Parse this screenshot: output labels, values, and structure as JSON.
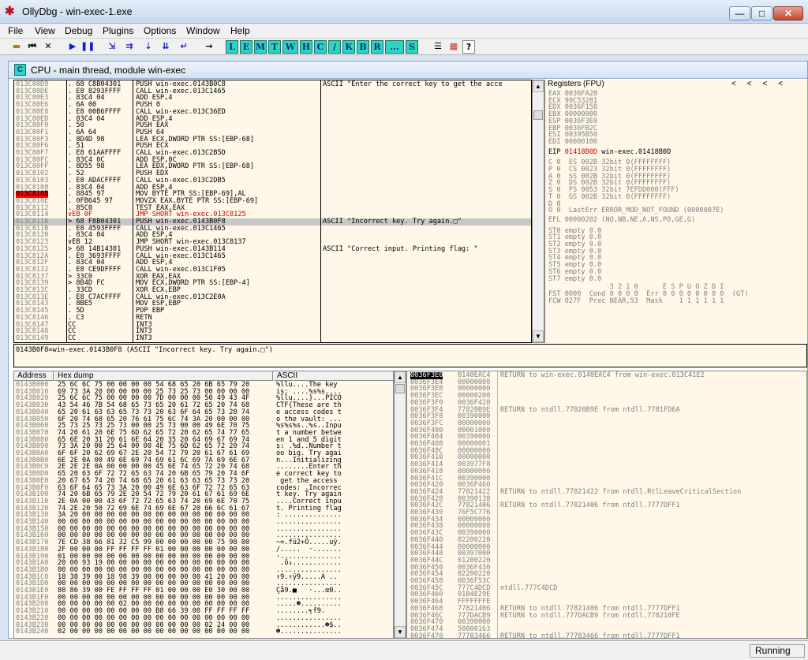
{
  "window": {
    "title": "OllyDbg - win-exec-1.exe",
    "min": "—",
    "max": "□",
    "close": "✕"
  },
  "menu": [
    "File",
    "View",
    "Debug",
    "Plugins",
    "Options",
    "Window",
    "Help"
  ],
  "toolbar": {
    "icons": [
      "open-icon",
      "rewind-icon",
      "close-program-icon",
      "run-icon",
      "pause-icon",
      "step-into-icon",
      "step-over-icon",
      "trace-into-icon",
      "trace-over-icon",
      "execute-till-return-icon",
      "go-to-icon"
    ],
    "letters": [
      "L",
      "E",
      "M",
      "T",
      "W",
      "H",
      "C",
      "/",
      "K",
      "B",
      "R",
      "...",
      "S"
    ],
    "extra_icons": [
      "list-icon",
      "color-grid-icon",
      "help-icon"
    ],
    "help_label": "?"
  },
  "cpu": {
    "icon_label": "C",
    "title": "CPU - main thread, module win-exec"
  },
  "disasm": {
    "rows": [
      [
        "013C80D9",
        ". 68 C8B04301",
        "PUSH win-exec.0143B0C8",
        "ASCII \"Enter the correct key to get the acce"
      ],
      [
        "013C80DE",
        ". E8 8293FFFF",
        "CALL win-exec.013C1465",
        ""
      ],
      [
        "013C80E3",
        ". 83C4 04",
        "ADD ESP,4",
        ""
      ],
      [
        "013C80E6",
        ". 6A 00",
        "PUSH 0",
        ""
      ],
      [
        "013C80E8",
        ". E8 00B6FFFF",
        "CALL win-exec.013C36ED",
        ""
      ],
      [
        "013C80ED",
        ". 83C4 04",
        "ADD ESP,4",
        ""
      ],
      [
        "013C80F0",
        ". 50",
        "PUSH EAX",
        ""
      ],
      [
        "013C80F1",
        ". 6A 64",
        "PUSH 64",
        ""
      ],
      [
        "013C80F3",
        ". 8D4D 98",
        "LEA ECX,DWORD PTR SS:[EBP-68]",
        ""
      ],
      [
        "013C80F6",
        ". 51",
        "PUSH ECX",
        ""
      ],
      [
        "013C80F7",
        ". E8 61AAFFFF",
        "CALL win-exec.013C2B5D",
        ""
      ],
      [
        "013C80FC",
        ". 83C4 0C",
        "ADD ESP,0C",
        ""
      ],
      [
        "013C80FF",
        ". 8D55 98",
        "LEA EDX,DWORD PTR SS:[EBP-68]",
        ""
      ],
      [
        "013C8102",
        ". 52",
        "PUSH EDX",
        ""
      ],
      [
        "013C8103",
        ". E8 ADACFFFF",
        "CALL win-exec.013C2DB5",
        ""
      ],
      [
        "013C8108",
        ". 83C4 04",
        "ADD ESP,4",
        ""
      ],
      [
        "013C810B",
        ". 8845 97",
        "MOV BYTE PTR SS:[EBP-69],AL",
        ""
      ],
      [
        "013C810E",
        ". 0FB645 97",
        "MOVZX EAX,BYTE PTR SS:[EBP-69]",
        ""
      ],
      [
        "013C8112",
        ". 85C0",
        "TEST EAX,EAX",
        ""
      ],
      [
        "013C8114",
        "∨EB 0F",
        "JMP SHORT win-exec.013C8125",
        ""
      ],
      [
        "013C8116",
        "> 68 F8B04301",
        "PUSH win-exec.0143B0F8",
        "ASCII \"Incorrect key. Try again.□\""
      ],
      [
        "013C811B",
        ". E8 4593FFFF",
        "CALL win-exec.013C1465",
        ""
      ],
      [
        "013C8120",
        ". 83C4 04",
        "ADD ESP,4",
        ""
      ],
      [
        "013C8123",
        "∨EB 12",
        "JMP SHORT win-exec.013C8137",
        ""
      ],
      [
        "013C8125",
        "> 68 14B14301",
        "PUSH win-exec.0143B114",
        "ASCII \"Correct input. Printing flag: \""
      ],
      [
        "013C812A",
        ". E8 3693FFFF",
        "CALL win-exec.013C1465",
        ""
      ],
      [
        "013C812F",
        ". 83C4 04",
        "ADD ESP,4",
        ""
      ],
      [
        "013C8132",
        ". E8 CE9DFFFF",
        "CALL win-exec.013C1F05",
        ""
      ],
      [
        "013C8137",
        "> 33C0",
        "XOR EAX,EAX",
        ""
      ],
      [
        "013C8139",
        "> 8B4D FC",
        "MOV ECX,DWORD PTR SS:[EBP-4]",
        ""
      ],
      [
        "013C813C",
        ". 33CD",
        "XOR ECX,EBP",
        ""
      ],
      [
        "013C813E",
        ". E8 C7ACFFFF",
        "CALL win-exec.013C2E0A",
        ""
      ],
      [
        "013C8143",
        ". 8BE5",
        "MOV ESP,EBP",
        ""
      ],
      [
        "013C8145",
        ". 5D",
        "POP EBP",
        ""
      ],
      [
        "013C8146",
        ". C3",
        "RETN",
        ""
      ],
      [
        "013C8147",
        "CC",
        "INT3",
        ""
      ],
      [
        "013C8148",
        "CC",
        "INT3",
        ""
      ],
      [
        "013C8149",
        "CC",
        "INT3",
        ""
      ]
    ],
    "eip_row": 16,
    "selected_row": 20,
    "jump_rows": [
      19
    ]
  },
  "info_line": "0143B0F8=win-exec.0143B0F8 (ASCII \"Incorrect key. Try again.□\")",
  "registers": {
    "title": "Registers (FPU)",
    "arrows": "<     <     <     <",
    "gp": [
      "EAX 0036FA28",
      "ECX 99C53281",
      "EDX 0036F158",
      "EBX 00000000",
      "ESP 0036F3E0",
      "EBP 0036FB2C",
      "ESI 00395B50",
      "EDI 00000100"
    ],
    "eip_label": "EIP",
    "eip_value": "01418B0D",
    "eip_sym": "win-exec.01418B0D",
    "flags": [
      "C 0  ES 002B 32bit 0(FFFFFFFF)",
      "P 0  CS 0023 32bit 0(FFFFFFFF)",
      "A 0  SS 002B 32bit 0(FFFFFFFF)",
      "Z 0  DS 002B 32bit 0(FFFFFFFF)",
      "S 0  FS 0053 32bit 7EFDD000(FFF)",
      "T 0  GS 002B 32bit 0(FFFFFFFF)",
      "D 0",
      "O 0  LastErr ERROR_MOD_NOT_FOUND (0000007E)"
    ],
    "efl": "EFL 00000202 (NO,NB,NE,A,NS,PO,GE,G)",
    "fpu": [
      "ST0 empty 0.0",
      "ST1 empty 0.0",
      "ST2 empty 0.0",
      "ST3 empty 0.0",
      "ST4 empty 0.0",
      "ST5 empty 0.0",
      "ST6 empty 0.0",
      "ST7 empty 0.0"
    ],
    "fpu_tail": [
      "               3 2 1 0      E S P U O Z D I",
      "FST 0000  Cond 0 0 0 0  Err 0 0 0 0 0 0 0 0  (GT)",
      "FCW 027F  Prec NEAR,53  Mask    1 1 1 1 1 1"
    ]
  },
  "dump": {
    "headers": [
      "Address",
      "Hex dump",
      "ASCII"
    ],
    "rows": [
      [
        "0143B000",
        "25 6C 6C 75 00 00 00 00 54 68 65 20 6B 65 79 20",
        "%llu....The key "
      ],
      [
        "0143B010",
        "69 73 3A 20 00 00 00 00 25 73 25 73 00 00 00 00",
        "is: ....%s%s...."
      ],
      [
        "0143B020",
        "25 6C 6C 75 00 00 00 00 7D 00 00 00 50 49 43 4F",
        "%llu....}...PICO"
      ],
      [
        "0143B030",
        "43 54 46 7B 54 68 65 73 65 20 61 72 65 20 74 68",
        "CTF{These are th"
      ],
      [
        "0143B040",
        "65 20 61 63 63 65 73 73 20 63 6F 64 65 73 20 74",
        "e access codes t"
      ],
      [
        "0143B050",
        "6F 20 74 68 65 20 76 61 75 6C 74 3A 20 00 00 00",
        "o the vault: ..."
      ],
      [
        "0143B060",
        "25 73 25 73 25 73 00 00 25 73 00 00 49 6E 70 75",
        "%s%s%s..%s..Inpu"
      ],
      [
        "0143B070",
        "74 20 61 20 6E 75 6D 62 65 72 20 62 65 74 77 65",
        "t a number betwe"
      ],
      [
        "0143B080",
        "65 6E 20 31 20 61 6E 64 20 35 20 64 69 67 69 74",
        "en 1 and 5 digit"
      ],
      [
        "0143B090",
        "73 3A 20 00 25 64 00 00 4E 75 6D 62 65 72 20 74",
        "s: .%d..Number t"
      ],
      [
        "0143B0A0",
        "6F 6F 20 62 69 67 2E 20 54 72 79 20 61 67 61 69",
        "oo big. Try agai"
      ],
      [
        "0143B0B0",
        "6E 2E 0A 00 49 6E 69 74 69 61 6C 69 7A 69 6E 67",
        "n...Initializing"
      ],
      [
        "0143B0C0",
        "2E 2E 2E 0A 00 00 00 00 45 6E 74 65 72 20 74 68",
        "........Enter th"
      ],
      [
        "0143B0D0",
        "65 20 63 6F 72 72 65 63 74 20 6B 65 79 20 74 6F",
        "e correct key to"
      ],
      [
        "0143B0E0",
        "20 67 65 74 20 74 68 65 20 61 63 63 65 73 73 20",
        " get the access "
      ],
      [
        "0143B0F0",
        "63 6F 64 65 73 3A 20 00 49 6E 63 6F 72 72 65 63",
        "codes: .Incorrec"
      ],
      [
        "0143B100",
        "74 20 6B 65 79 2E 20 54 72 79 20 61 67 61 69 6E",
        "t key. Try again"
      ],
      [
        "0143B110",
        "2E 0A 00 00 43 6F 72 72 65 63 74 20 69 6E 70 75",
        "....Correct inpu"
      ],
      [
        "0143B120",
        "74 2E 20 50 72 69 6E 74 69 6E 67 20 66 6C 61 67",
        "t. Printing flag"
      ],
      [
        "0143B130",
        "3A 20 00 00 00 00 00 00 00 00 00 00 00 00 00 00",
        ": .............."
      ],
      [
        "0143B140",
        "00 00 00 00 00 00 00 00 00 00 00 00 00 00 00 00",
        "................"
      ],
      [
        "0143B150",
        "00 00 00 00 00 00 00 00 00 00 00 00 00 00 00 00",
        "................"
      ],
      [
        "0143B160",
        "00 00 00 00 00 00 00 00 00 00 00 00 00 00 00 00",
        "................"
      ],
      [
        "0143B170",
        "7E CD 38 66 81 32 C5 99 00 00 00 00 00 75 98 00",
        "~=.fü2+Ö.....uÿ."
      ],
      [
        "0143B180",
        "2F 00 00 00 FF FF FF FF 01 00 00 00 00 00 00 00",
        "/.....  ·......."
      ],
      [
        "0143B190",
        "01 00 00 00 00 00 00 00 00 00 00 00 00 00 00 00",
        "·..............."
      ],
      [
        "0143B1A0",
        "20 00 93 19 00 00 00 00 00 00 00 00 00 00 00 00",
        " .ô↓............"
      ],
      [
        "0143B1B0",
        "00 00 00 00 00 00 00 00 00 00 00 00 00 00 00 00",
        "................"
      ],
      [
        "0143B1C0",
        "18 38 39 00 18 98 39 00 00 00 00 00 41 20 00 00",
        "↑9.↑ÿ9.....A .."
      ],
      [
        "0143B1D0",
        "00 00 00 00 00 00 00 00 00 00 00 00 00 00 00 00",
        "................"
      ],
      [
        "0143B1E0",
        "80 86 39 00 FE FF FF FF 01 00 00 00 E0 30 00 00",
        "Çå9.■   ·...α0.."
      ],
      [
        "0143B1F0",
        "00 00 00 00 00 00 00 00 00 00 00 00 00 00 00 00",
        "................"
      ],
      [
        "0143B200",
        "00 00 00 00 00 02 00 00 00 00 00 00 00 00 00 00",
        ".....☻.........."
      ],
      [
        "0143B210",
        "00 00 00 00 00 00 00 00 B8 66 39 00 FF FF FF FF",
        "........╕f9.    "
      ],
      [
        "0143B220",
        "00 00 00 00 00 00 00 00 00 00 00 00 00 00 00 00",
        "................"
      ],
      [
        "0143B230",
        "00 00 00 00 00 00 00 00 00 00 00 00 02 24 00 00",
        "............☻$.."
      ],
      [
        "0143B240",
        "02 00 00 00 00 00 00 00 00 00 00 00 00 00 00 00",
        "☻..............."
      ]
    ]
  },
  "stack": {
    "rows": [
      [
        "0036F3E0",
        "0140EAC4",
        "RETURN to win-exec.0140EAC4 from win-exec.013C41E2"
      ],
      [
        "0036F3E4",
        "00000000",
        ""
      ],
      [
        "0036F3E8",
        "00000000",
        ""
      ],
      [
        "0036F3EC",
        "00000200",
        ""
      ],
      [
        "0036F3F0",
        "0036F420",
        ""
      ],
      [
        "0036F3F4",
        "77820B9E",
        "RETURN to ntdll.77820B9E from ntdll.7781FD6A"
      ],
      [
        "0036F3F8",
        "00390000",
        ""
      ],
      [
        "0036F3FC",
        "00000000",
        ""
      ],
      [
        "0036F400",
        "00001000",
        ""
      ],
      [
        "0036F404",
        "00390000",
        ""
      ],
      [
        "0036F408",
        "00000001",
        ""
      ],
      [
        "0036F40C",
        "00000000",
        ""
      ],
      [
        "0036F410",
        "00000000",
        ""
      ],
      [
        "0036F414",
        "003977F8",
        ""
      ],
      [
        "0036F418",
        "00000000",
        ""
      ],
      [
        "0036F41C",
        "00390000",
        ""
      ],
      [
        "0036F420",
        "0036F460",
        ""
      ],
      [
        "0036F424",
        "77821422",
        "RETURN to ntdll.77821422 from ntdll.RtlLeaveCriticalSection"
      ],
      [
        "0036F428",
        "00390138",
        ""
      ],
      [
        "0036F42C",
        "77821406",
        "RETURN to ntdll.77821406 from ntdll.7777DFF1"
      ],
      [
        "0036F430",
        "76F5C776",
        ""
      ],
      [
        "0036F434",
        "00000000",
        ""
      ],
      [
        "0036F438",
        "00000000",
        ""
      ],
      [
        "0036F43C",
        "00390000",
        ""
      ],
      [
        "0036F440",
        "02200220",
        ""
      ],
      [
        "0036F444",
        "00000000",
        ""
      ],
      [
        "0036F448",
        "00397000",
        ""
      ],
      [
        "0036F44C",
        "01200220",
        ""
      ],
      [
        "0036F450",
        "0036F430",
        ""
      ],
      [
        "0036F454",
        "02200220",
        ""
      ],
      [
        "0036F458",
        "0036F53C",
        ""
      ],
      [
        "0036F45C",
        "777C4DCD",
        "ntdll.777C4DCD"
      ],
      [
        "0036F460",
        "01B4E29E",
        ""
      ],
      [
        "0036F464",
        "FFFFFFFE",
        ""
      ],
      [
        "0036F468",
        "77821406",
        "RETURN to ntdll.77821406 from ntdll.7777DFF1"
      ],
      [
        "0036F46C",
        "777DACB9",
        "RETURN to ntdll.777DACB9 from ntdll.778210FE"
      ],
      [
        "0036F470",
        "00390000",
        ""
      ],
      [
        "0036F474",
        "50000163",
        ""
      ],
      [
        "0036F478",
        "77783466",
        "RETURN to ntdll.77783466 from ntdll.7777DFF1"
      ]
    ]
  },
  "status": "Running"
}
